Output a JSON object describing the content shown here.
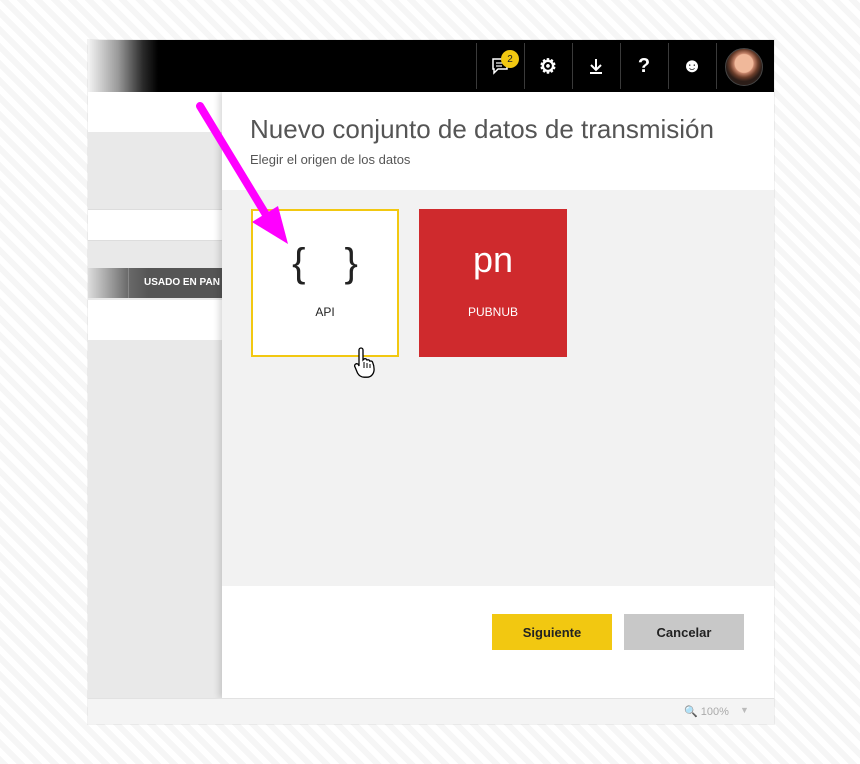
{
  "topbar": {
    "notifications_count": "2",
    "icons": [
      "notifications-icon",
      "gear-icon",
      "download-icon",
      "help-icon",
      "smiley-icon",
      "avatar"
    ]
  },
  "background_page": {
    "column_header": "USADO EN PAN"
  },
  "dialog": {
    "title": "Nuevo conjunto de datos de transmisión",
    "subtitle": "Elegir el origen de los datos",
    "sources": [
      {
        "glyph": "{ }",
        "label": "API",
        "selected": true
      },
      {
        "glyph": "pn",
        "label": "PUBNUB",
        "selected": false,
        "color": "#cf2a2d"
      }
    ],
    "next_label": "Siguiente",
    "cancel_label": "Cancelar"
  },
  "statusbar": {
    "zoom": "100%"
  },
  "colors": {
    "accent": "#f2c811",
    "pubnub": "#cf2a2d",
    "annotation_arrow": "#ff00ff"
  }
}
